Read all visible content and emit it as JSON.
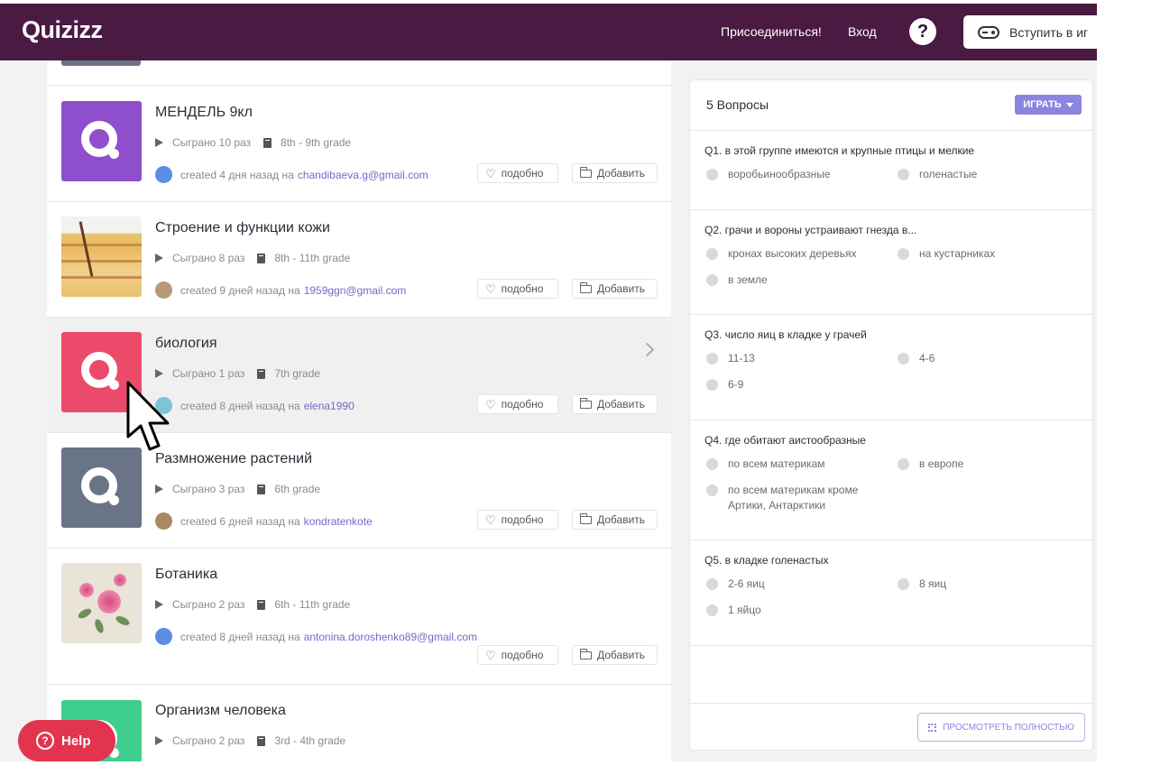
{
  "header": {
    "logo": "Quizizz",
    "join_label": "Присоединиться!",
    "login_label": "Вход",
    "help_icon": "?",
    "join_game_label": "Вступить в иг"
  },
  "quizzes": [
    {
      "title": "МЕНДЕЛЬ 9кл",
      "plays": "Сыграно 10 раз",
      "grade": "8th - 9th grade",
      "created": "created 4 дня назад на",
      "author": "chandibaeva.g@gmail.com",
      "like": "подобно",
      "add": "Добавить",
      "thumb_color": "#8f4fcc"
    },
    {
      "title": "Строение и функции кожи",
      "plays": "Сыграно 8 раз",
      "grade": "8th - 11th grade",
      "created": "created 9 дней назад на",
      "author": "1959ggn@gmail.com",
      "like": "подобно",
      "add": "Добавить"
    },
    {
      "title": "биология",
      "plays": "Сыграно 1 раз",
      "grade": "7th grade",
      "created": "created 8 дней назад на",
      "author": "elena1990",
      "like": "подобно",
      "add": "Добавить",
      "thumb_color": "#ec4a6b"
    },
    {
      "title": "Размножение растений",
      "plays": "Сыграно 3 раз",
      "grade": "6th grade",
      "created": "created 6 дней назад на",
      "author": "kondratenkote",
      "like": "подобно",
      "add": "Добавить",
      "thumb_color": "#6a7487"
    },
    {
      "title": "Ботаника",
      "plays": "Сыграно 2 раз",
      "grade": "6th - 11th grade",
      "created": "created 8 дней назад на",
      "author": "antonina.doroshenko89@gmail.com",
      "like": "подобно",
      "add": "Добавить"
    },
    {
      "title": "Организм человека",
      "plays": "Сыграно 2 раз",
      "grade": "3rd - 4th grade",
      "thumb_color": "#3ecf8e"
    }
  ],
  "panel": {
    "title": "5 Вопросы",
    "play_label": "ИГРАТЬ",
    "view_full_label": "ПРОСМОТРЕТЬ ПОЛНОСТЬЮ",
    "questions": [
      {
        "text": "Q1. в этой группе имеются и крупные птицы и мелкие",
        "options": [
          "воробьинообразные",
          "голенастые"
        ]
      },
      {
        "text": "Q2. грачи  и вороны устраивают гнезда в...",
        "options": [
          "кронах высоких деревьях",
          "на кустарниках",
          "в земле"
        ]
      },
      {
        "text": "Q3. число яиц в кладке у грачей",
        "options": [
          "11-13",
          "4-6",
          "6-9"
        ]
      },
      {
        "text": "Q4. где обитают аистообразные",
        "options": [
          "по всем материкам",
          "в европе",
          "по всем материкам кроме Артики, Антарктики"
        ]
      },
      {
        "text": "Q5. в кладке голенастых",
        "options": [
          "2-6 яиц",
          "8 яиц",
          "1 яйцо"
        ]
      }
    ]
  },
  "help": {
    "label": "Help"
  },
  "colors": {
    "header": "#4a1a42",
    "accent": "#8b85e0",
    "help": "#e3344e",
    "link": "#6f6cc8"
  }
}
